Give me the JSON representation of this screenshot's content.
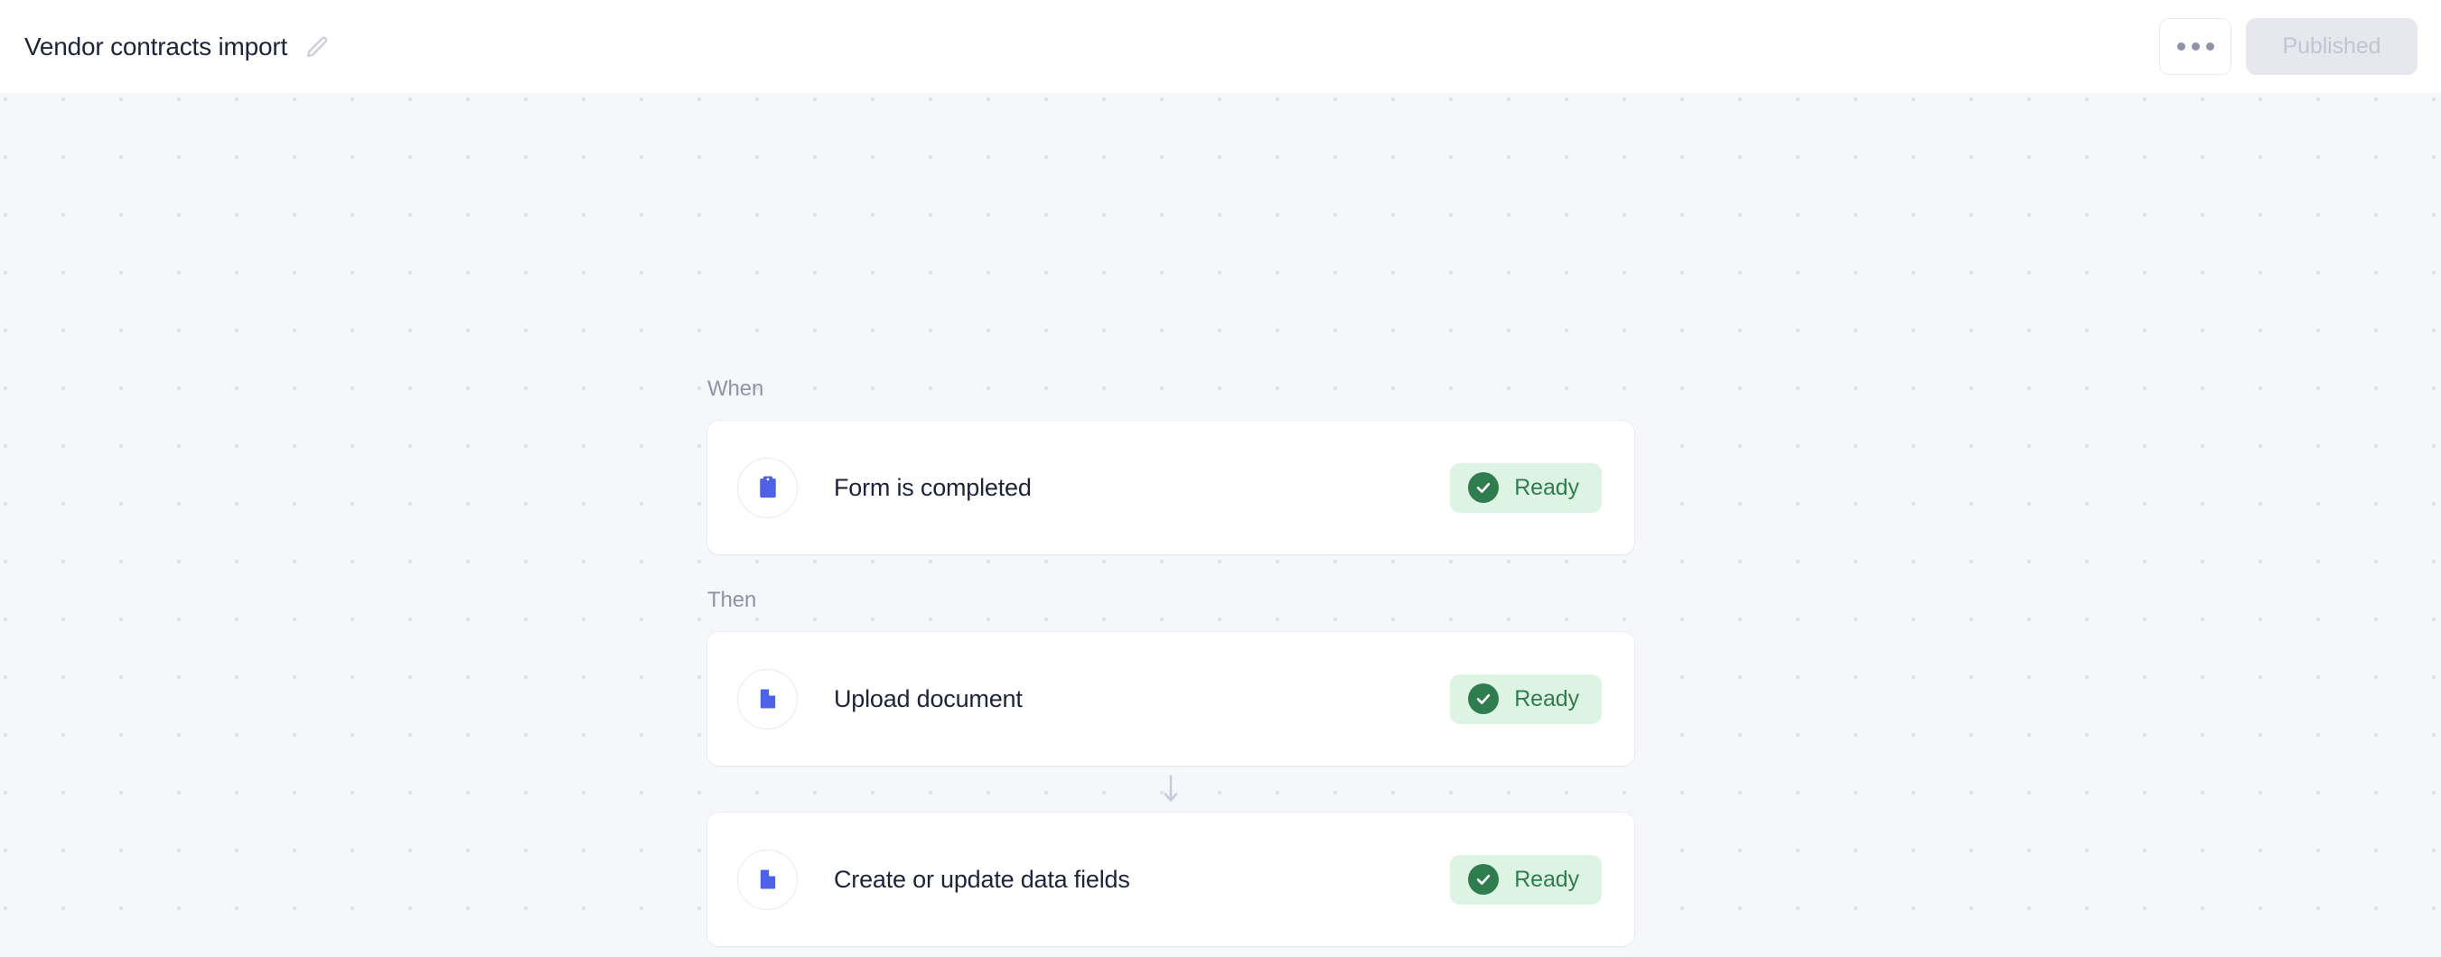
{
  "header": {
    "title": "Vendor contracts import",
    "edit_icon": "pencil-icon",
    "more_options_icon": "ellipsis-icon",
    "publish_label": "Published"
  },
  "canvas": {
    "when_label": "When",
    "then_label": "Then",
    "connector_icon": "arrow-down-icon",
    "trigger": {
      "icon": "clipboard-icon",
      "title": "Form is completed",
      "status": "Ready",
      "status_icon": "check-circle-icon"
    },
    "actions": [
      {
        "icon": "document-icon",
        "title": "Upload document",
        "status": "Ready",
        "status_icon": "check-circle-icon"
      },
      {
        "icon": "document-icon",
        "title": "Create or update data fields",
        "status": "Ready",
        "status_icon": "check-circle-icon"
      }
    ]
  },
  "colors": {
    "accent_blue": "#4e62e8",
    "status_green_text": "#2f7d4f",
    "status_green_bg": "#ddf3e3",
    "canvas_bg": "#f6f7fa",
    "title_navy": "#1e2339",
    "muted_gray": "#8f93a6"
  }
}
